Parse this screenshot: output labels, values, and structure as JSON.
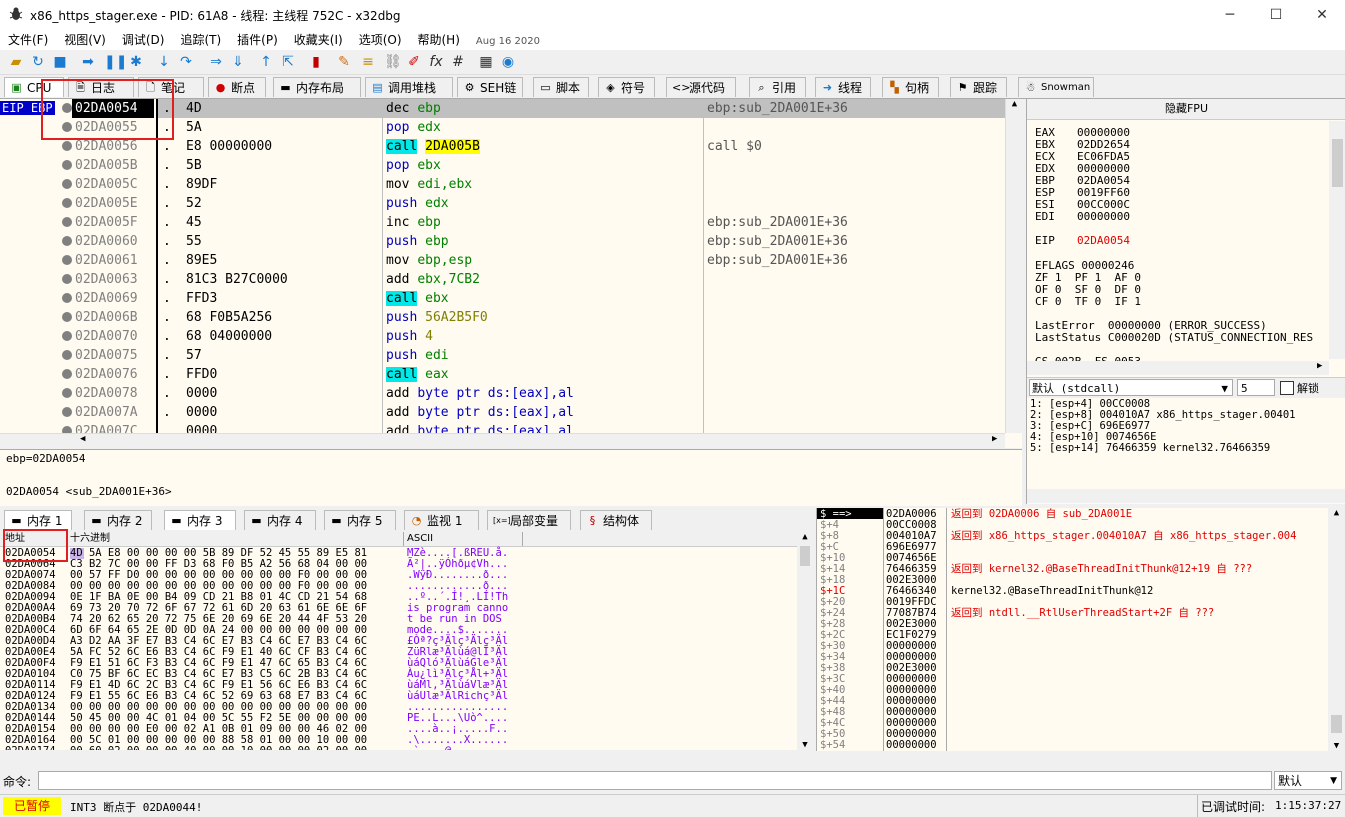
{
  "window": {
    "title": "x86_https_stager.exe - PID: 61A8 - 线程: 主线程 752C - x32dbg"
  },
  "menu": {
    "items": [
      "文件(F)",
      "视图(V)",
      "调试(D)",
      "追踪(T)",
      "插件(P)",
      "收藏夹(I)",
      "选项(O)",
      "帮助(H)"
    ],
    "date": "Aug 16 2020"
  },
  "tabs": [
    {
      "label": "CPU",
      "icon": "cpu-icon"
    },
    {
      "label": "日志",
      "icon": "log-icon"
    },
    {
      "label": "笔记",
      "icon": "notes-icon"
    },
    {
      "label": "断点",
      "icon": "breakpoint-icon"
    },
    {
      "label": "内存布局",
      "icon": "memory-map-icon"
    },
    {
      "label": "调用堆栈",
      "icon": "call-stack-icon"
    },
    {
      "label": "SEH链",
      "icon": "seh-icon"
    },
    {
      "label": "脚本",
      "icon": "script-icon"
    },
    {
      "label": "符号",
      "icon": "symbol-icon"
    },
    {
      "label": "源代码",
      "icon": "source-icon"
    },
    {
      "label": "引用",
      "icon": "reference-icon"
    },
    {
      "label": "线程",
      "icon": "thread-icon"
    },
    {
      "label": "句柄",
      "icon": "handle-icon"
    },
    {
      "label": "跟踪",
      "icon": "trace-icon"
    },
    {
      "label": "Snowman",
      "icon": "snowman-icon"
    }
  ],
  "disasm": {
    "eip_label": "EIP EBP",
    "rows": [
      {
        "addr": "02DA0054",
        "dot": ".",
        "bytes": "4D",
        "mn": "dec",
        "ops": "ebp",
        "cmt": "ebp:sub_2DA001E+36"
      },
      {
        "addr": "02DA0055",
        "dot": ".",
        "bytes": "5A",
        "mn": "pop",
        "ops": "edx",
        "cmt": ""
      },
      {
        "addr": "02DA0056",
        "dot": ".",
        "bytes": "E8 00000000",
        "mn": "call",
        "ops": "2DA005B",
        "cmt": "call $0"
      },
      {
        "addr": "02DA005B",
        "dot": ".",
        "bytes": "5B",
        "mn": "pop",
        "ops": "ebx",
        "cmt": ""
      },
      {
        "addr": "02DA005C",
        "dot": ".",
        "bytes": "89DF",
        "mn": "mov",
        "ops": "edi,ebx",
        "cmt": ""
      },
      {
        "addr": "02DA005E",
        "dot": ".",
        "bytes": "52",
        "mn": "push",
        "ops": "edx",
        "cmt": ""
      },
      {
        "addr": "02DA005F",
        "dot": ".",
        "bytes": "45",
        "mn": "inc",
        "ops": "ebp",
        "cmt": "ebp:sub_2DA001E+36"
      },
      {
        "addr": "02DA0060",
        "dot": ".",
        "bytes": "55",
        "mn": "push",
        "ops": "ebp",
        "cmt": "ebp:sub_2DA001E+36"
      },
      {
        "addr": "02DA0061",
        "dot": ".",
        "bytes": "89E5",
        "mn": "mov",
        "ops": "ebp,esp",
        "cmt": "ebp:sub_2DA001E+36"
      },
      {
        "addr": "02DA0063",
        "dot": ".",
        "bytes": "81C3 B27C0000",
        "mn": "add",
        "ops": "ebx,7CB2",
        "cmt": ""
      },
      {
        "addr": "02DA0069",
        "dot": ".",
        "bytes": "FFD3",
        "mn": "call",
        "ops": "ebx",
        "cmt": ""
      },
      {
        "addr": "02DA006B",
        "dot": ".",
        "bytes": "68 F0B5A256",
        "mn": "push",
        "ops": "56A2B5F0",
        "cmt": ""
      },
      {
        "addr": "02DA0070",
        "dot": ".",
        "bytes": "68 04000000",
        "mn": "push",
        "ops": "4",
        "cmt": ""
      },
      {
        "addr": "02DA0075",
        "dot": ".",
        "bytes": "57",
        "mn": "push",
        "ops": "edi",
        "cmt": ""
      },
      {
        "addr": "02DA0076",
        "dot": ".",
        "bytes": "FFD0",
        "mn": "call",
        "ops": "eax",
        "cmt": ""
      },
      {
        "addr": "02DA0078",
        "dot": ".",
        "bytes": "0000",
        "mn": "add",
        "ops": "byte ptr ds:[eax],al",
        "cmt": ""
      },
      {
        "addr": "02DA007A",
        "dot": ".",
        "bytes": "0000",
        "mn": "add",
        "ops": "byte ptr ds:[eax],al",
        "cmt": ""
      },
      {
        "addr": "02DA007C",
        "dot": ".",
        "bytes": "0000",
        "mn": "add",
        "ops": "byte ptr ds:[eax],al",
        "cmt": ""
      }
    ]
  },
  "regs": {
    "hide_fpu": "隐藏FPU",
    "gp": [
      {
        "n": "EAX",
        "v": "00000000"
      },
      {
        "n": "EBX",
        "v": "02DD2654"
      },
      {
        "n": "ECX",
        "v": "EC06FDA5"
      },
      {
        "n": "EDX",
        "v": "00000000"
      },
      {
        "n": "EBP",
        "v": "02DA0054"
      },
      {
        "n": "ESP",
        "v": "0019FF60"
      },
      {
        "n": "ESI",
        "v": "00CC000C"
      },
      {
        "n": "EDI",
        "v": "00000000"
      }
    ],
    "eip_name": "EIP",
    "eip": "02DA0054",
    "eflags_line": "EFLAGS   00000246",
    "flags1": "ZF 1  PF 1  AF 0",
    "flags2": "OF 0  SF 0  DF 0",
    "flags3": "CF 0  TF 0  IF 1",
    "lasterror": "LastError  00000000 (ERROR_SUCCESS)",
    "laststatus": "LastStatus C000020D (STATUS_CONNECTION_RES",
    "cc_line": "GS 002B  FS 0053",
    "callconv": "默认 (stdcall)",
    "argcount": "5",
    "unlock": "解锁",
    "args": [
      "1: [esp+4] 00CC0008",
      "2: [esp+8] 004010A7 x86_https_stager.00401",
      "3: [esp+C] 696E6977",
      "4: [esp+10] 0074656E",
      "5: [esp+14] 76466359 kernel32.76466359"
    ]
  },
  "info": {
    "line1": "ebp=02DA0054",
    "line2": "02DA0054 <sub_2DA001E+36>"
  },
  "memtabs": [
    "内存 1",
    "内存 2",
    "内存 3",
    "内存 4",
    "内存 5",
    "监视 1",
    "局部变量",
    "结构体"
  ],
  "mem": {
    "col_addr": "地址",
    "col_hex": "十六进制",
    "col_ascii": "ASCII",
    "rows": [
      {
        "a": "02DA0054",
        "h": "4D 5A E8 00 00 00 00 5B 89 DF 52 45 55 89 E5 81",
        "s": "MZè....[.ßREU.å."
      },
      {
        "a": "02DA0064",
        "h": "C3 B2 7C 00 00 FF D3 68 F0 B5 A2 56 68 04 00 00",
        "s": "Ã²|..ÿÓhðµ¢Vh..."
      },
      {
        "a": "02DA0074",
        "h": "00 57 FF D0 00 00 00 00 00 00 00 00 F0 00 00 00",
        "s": ".WÿÐ........ð..."
      },
      {
        "a": "02DA0084",
        "h": "00 00 00 00 00 00 00 00 00 00 00 00 F0 00 00 00",
        "s": "............ð..."
      },
      {
        "a": "02DA0094",
        "h": "0E 1F BA 0E 00 B4 09 CD 21 B8 01 4C CD 21 54 68",
        "s": "..º..´.Í!¸.LÍ!Th"
      },
      {
        "a": "02DA00A4",
        "h": "69 73 20 70 72 6F 67 72 61 6D 20 63 61 6E 6E 6F",
        "s": "is program canno"
      },
      {
        "a": "02DA00B4",
        "h": "74 20 62 65 20 72 75 6E 20 69 6E 20 44 4F 53 20",
        "s": "t be run in DOS "
      },
      {
        "a": "02DA00C4",
        "h": "6D 6F 64 65 2E 0D 0D 0A 24 00 00 00 00 00 00 00",
        "s": "mode....$......."
      },
      {
        "a": "02DA00D4",
        "h": "A3 D2 AA 3F E7 B3 C4 6C E7 B3 C4 6C E7 B3 C4 6C",
        "s": "£Òª?ç³Älç³Älç³Äl"
      },
      {
        "a": "02DA00E4",
        "h": "5A FC 52 6C E6 B3 C4 6C F9 E1 40 6C CF B3 C4 6C",
        "s": "ZüRlæ³Älùá@lÏ³Äl"
      },
      {
        "a": "02DA00F4",
        "h": "F9 E1 51 6C F3 B3 C4 6C F9 E1 47 6C 65 B3 C4 6C",
        "s": "ùáQló³ÄlùáGle³Äl"
      },
      {
        "a": "02DA0104",
        "h": "C0 75 BF 6C EC B3 C4 6C E7 B3 C5 6C 2B B3 C4 6C",
        "s": "Àu¿lì³Älç³Ål+³Äl"
      },
      {
        "a": "02DA0114",
        "h": "F9 E1 4D 6C 2C B3 C4 6C F9 E1 56 6C E6 B3 C4 6C",
        "s": "ùáMl,³ÄlùáVlæ³Äl"
      },
      {
        "a": "02DA0124",
        "h": "F9 E1 55 6C E6 B3 C4 6C 52 69 63 68 E7 B3 C4 6C",
        "s": "ùáUlæ³ÄlRichç³Äl"
      },
      {
        "a": "02DA0134",
        "h": "00 00 00 00 00 00 00 00 00 00 00 00 00 00 00 00",
        "s": "................"
      },
      {
        "a": "02DA0144",
        "h": "50 45 00 00 4C 01 04 00 5C 55 F2 5E 00 00 00 00",
        "s": "PE..L...\\Uò^...."
      },
      {
        "a": "02DA0154",
        "h": "00 00 00 00 E0 00 02 A1 0B 01 09 00 00 46 02 00",
        "s": "....à..¡.....F.."
      },
      {
        "a": "02DA0164",
        "h": "00 5C 01 00 00 00 00 00 88 58 01 00 00 10 00 00",
        "s": ".\\.......X......"
      },
      {
        "a": "02DA0174",
        "h": "00 60 02 00 00 00 40 00 00 10 00 00 00 02 00 00",
        "s": ".`....@........."
      }
    ]
  },
  "stack": {
    "rows": [
      {
        "o": "$ ==>",
        "v": "02DA0006",
        "c": "返回到 02DA0006 自 sub_2DA001E"
      },
      {
        "o": "$+4",
        "v": "00CC0008",
        "c": ""
      },
      {
        "o": "$+8",
        "v": "004010A7",
        "c": "返回到 x86_https_stager.004010A7 自 x86_https_stager.004"
      },
      {
        "o": "$+C",
        "v": "696E6977",
        "c": ""
      },
      {
        "o": "$+10",
        "v": "0074656E",
        "c": ""
      },
      {
        "o": "$+14",
        "v": "76466359",
        "c": "返回到 kernel32.@BaseThreadInitThunk@12+19 自 ???"
      },
      {
        "o": "$+18",
        "v": "002E3000",
        "c": ""
      },
      {
        "o": "$+1C",
        "v": "76466340",
        "c": "kernel32.@BaseThreadInitThunk@12"
      },
      {
        "o": "$+20",
        "v": "0019FFDC",
        "c": ""
      },
      {
        "o": "$+24",
        "v": "77087B74",
        "c": "返回到 ntdll.__RtlUserThreadStart+2F 自 ???"
      },
      {
        "o": "$+28",
        "v": "002E3000",
        "c": ""
      },
      {
        "o": "$+2C",
        "v": "EC1F0279",
        "c": ""
      },
      {
        "o": "$+30",
        "v": "00000000",
        "c": ""
      },
      {
        "o": "$+34",
        "v": "00000000",
        "c": ""
      },
      {
        "o": "$+38",
        "v": "002E3000",
        "c": ""
      },
      {
        "o": "$+3C",
        "v": "00000000",
        "c": ""
      },
      {
        "o": "$+40",
        "v": "00000000",
        "c": ""
      },
      {
        "o": "$+44",
        "v": "00000000",
        "c": ""
      },
      {
        "o": "$+48",
        "v": "00000000",
        "c": ""
      },
      {
        "o": "$+4C",
        "v": "00000000",
        "c": ""
      },
      {
        "o": "$+50",
        "v": "00000000",
        "c": ""
      },
      {
        "o": "$+54",
        "v": "00000000",
        "c": ""
      }
    ]
  },
  "cmd": {
    "label": "命令:",
    "value": "",
    "mode": "默认"
  },
  "status": {
    "paused": "已暂停",
    "message": "INT3 断点于 02DA0044!",
    "debug_time_label": "已调试时间:",
    "debug_time": "1:15:37:27"
  },
  "colors": {
    "bg_pane": "#fffbf0",
    "mnemonic": "#0000c0",
    "call_highlight": "#00e8e8",
    "target_highlight": "#ffff00",
    "stack_comment": "#e00000",
    "paused_bg": "#ffff00"
  }
}
